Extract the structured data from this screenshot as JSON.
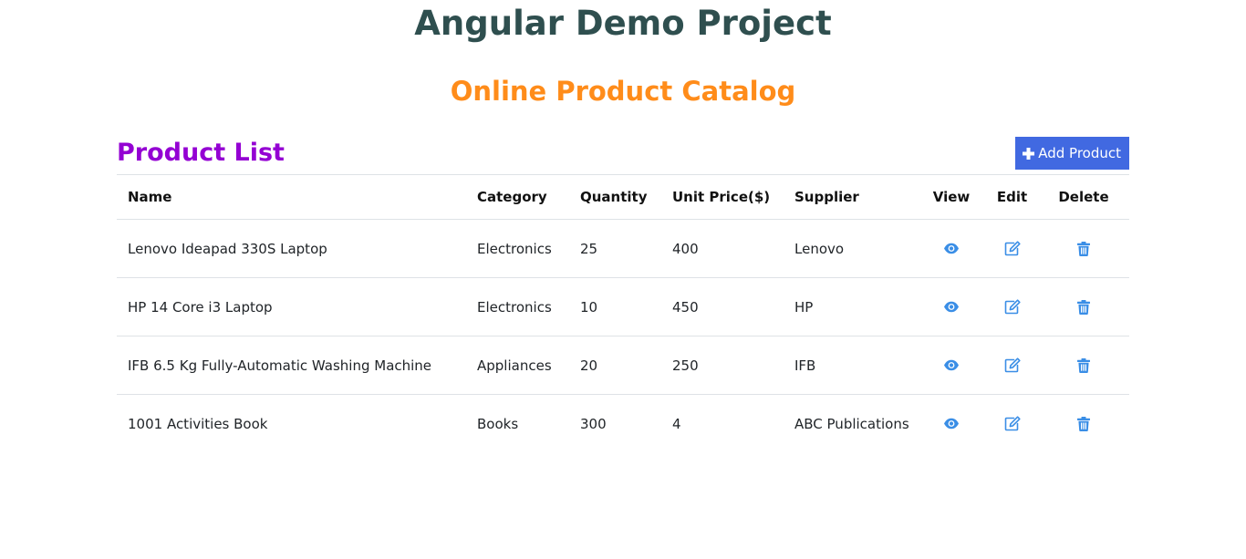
{
  "header": {
    "app_title": "Angular Demo Project",
    "catalog_title": "Online Product Catalog"
  },
  "product_list": {
    "title": "Product List",
    "add_button_label": "Add Product",
    "columns": {
      "name": "Name",
      "category": "Category",
      "quantity": "Quantity",
      "unit_price": "Unit Price($)",
      "supplier": "Supplier",
      "view": "View",
      "edit": "Edit",
      "delete": "Delete"
    },
    "rows": [
      {
        "name": "Lenovo Ideapad 330S Laptop",
        "category": "Electronics",
        "quantity": "25",
        "unit_price": "400",
        "supplier": "Lenovo"
      },
      {
        "name": "HP 14 Core i3 Laptop",
        "category": "Electronics",
        "quantity": "10",
        "unit_price": "450",
        "supplier": "HP"
      },
      {
        "name": "IFB 6.5 Kg Fully-Automatic Washing Machine",
        "category": "Appliances",
        "quantity": "20",
        "unit_price": "250",
        "supplier": "IFB"
      },
      {
        "name": "1001 Activities Book",
        "category": "Books",
        "quantity": "300",
        "unit_price": "4",
        "supplier": "ABC Publications"
      }
    ]
  },
  "icons": {
    "add": "plus-icon",
    "view": "eye-icon",
    "edit": "edit-icon",
    "delete": "trash-icon"
  },
  "colors": {
    "app_title": "#2f4f4f",
    "catalog_title": "#ff8c1a",
    "list_title": "#9400d3",
    "add_button": "#4169e1",
    "action_icon": "#3a8ee6"
  }
}
